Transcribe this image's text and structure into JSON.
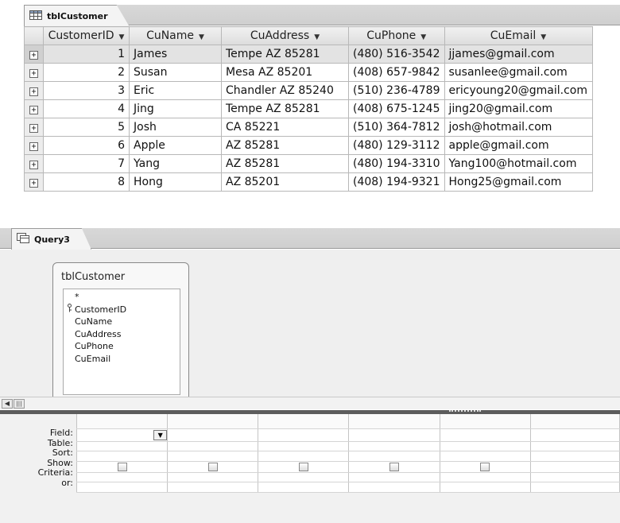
{
  "datasheet": {
    "tab_label": "tblCustomer",
    "columns": [
      "CustomerID",
      "CuName",
      "CuAddress",
      "CuPhone",
      "CuEmail"
    ],
    "rows": [
      {
        "id": "1",
        "name": "James",
        "address": "Tempe AZ 85281",
        "phone": "(480) 516-3542",
        "email": "jjames@gmail.com"
      },
      {
        "id": "2",
        "name": "Susan",
        "address": "Mesa AZ 85201",
        "phone": "(408) 657-9842",
        "email": "susanlee@gmail.com"
      },
      {
        "id": "3",
        "name": "Eric",
        "address": "Chandler AZ 85240",
        "phone": "(510) 236-4789",
        "email": "ericyoung20@gmail.com"
      },
      {
        "id": "4",
        "name": "Jing",
        "address": "Tempe AZ 85281",
        "phone": "(408) 675-1245",
        "email": "jing20@gmail.com"
      },
      {
        "id": "5",
        "name": "Josh",
        "address": "CA 85221",
        "phone": "(510) 364-7812",
        "email": "josh@hotmail.com"
      },
      {
        "id": "6",
        "name": "Apple",
        "address": "AZ 85281",
        "phone": "(480) 129-3112",
        "email": "apple@gmail.com"
      },
      {
        "id": "7",
        "name": "Yang",
        "address": "AZ 85281",
        "phone": "(480) 194-3310",
        "email": "Yang100@hotmail.com"
      },
      {
        "id": "8",
        "name": "Hong",
        "address": "AZ 85201",
        "phone": "(408) 194-9321",
        "email": "Hong25@gmail.com"
      }
    ]
  },
  "query": {
    "tab_label": "Query3",
    "table_box": {
      "title": "tblCustomer",
      "fields": [
        "*",
        "CustomerID",
        "CuName",
        "CuAddress",
        "CuPhone",
        "CuEmail"
      ]
    },
    "row_labels": [
      "Field:",
      "Table:",
      "Sort:",
      "Show:",
      "Criteria:",
      "or:"
    ]
  },
  "icons": {
    "table_tab": "table-icon",
    "query_tab": "query-icon",
    "key": "primary-key-icon"
  }
}
